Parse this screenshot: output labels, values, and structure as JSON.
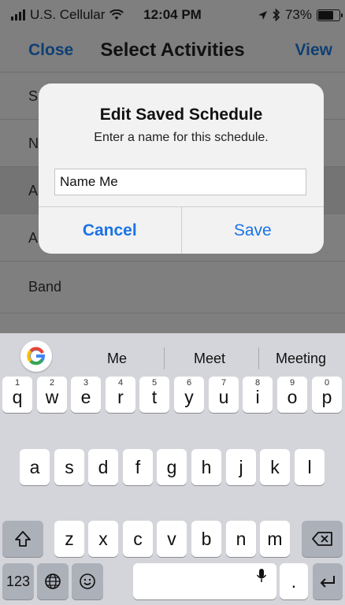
{
  "status_bar": {
    "carrier": "U.S. Cellular",
    "time": "12:04 PM",
    "battery": "73%",
    "battery_level": 0.73,
    "icons": [
      "signal-icon",
      "wifi-icon",
      "location-icon",
      "bluetooth-icon",
      "battery-icon"
    ]
  },
  "nav": {
    "close": "Close",
    "title": "Select Activities",
    "view": "View"
  },
  "list": {
    "rows": [
      {
        "label": "S"
      },
      {
        "label": "N"
      },
      {
        "label": "A"
      },
      {
        "label": "A"
      },
      {
        "label": "Band"
      },
      {
        "label": ""
      }
    ]
  },
  "alert": {
    "title": "Edit Saved Schedule",
    "message": "Enter a name for this schedule.",
    "input_value": "Name Me",
    "cancel": "Cancel",
    "save": "Save"
  },
  "keyboard": {
    "suggestions": [
      "Me",
      "Meet",
      "Meeting"
    ],
    "row1": [
      {
        "k": "q",
        "h": "1"
      },
      {
        "k": "w",
        "h": "2"
      },
      {
        "k": "e",
        "h": "3"
      },
      {
        "k": "r",
        "h": "4"
      },
      {
        "k": "t",
        "h": "5"
      },
      {
        "k": "y",
        "h": "6"
      },
      {
        "k": "u",
        "h": "7"
      },
      {
        "k": "i",
        "h": "8"
      },
      {
        "k": "o",
        "h": "9"
      },
      {
        "k": "p",
        "h": "0"
      }
    ],
    "row2": [
      "a",
      "s",
      "d",
      "f",
      "g",
      "h",
      "j",
      "k",
      "l"
    ],
    "row3": [
      "z",
      "x",
      "c",
      "v",
      "b",
      "n",
      "m"
    ],
    "numbers_key": "123",
    "period_key": "."
  },
  "colors": {
    "link_blue": "#1a73e8",
    "nav_link": "#0f3f74",
    "keyboard_bg": "#d3d5da"
  }
}
